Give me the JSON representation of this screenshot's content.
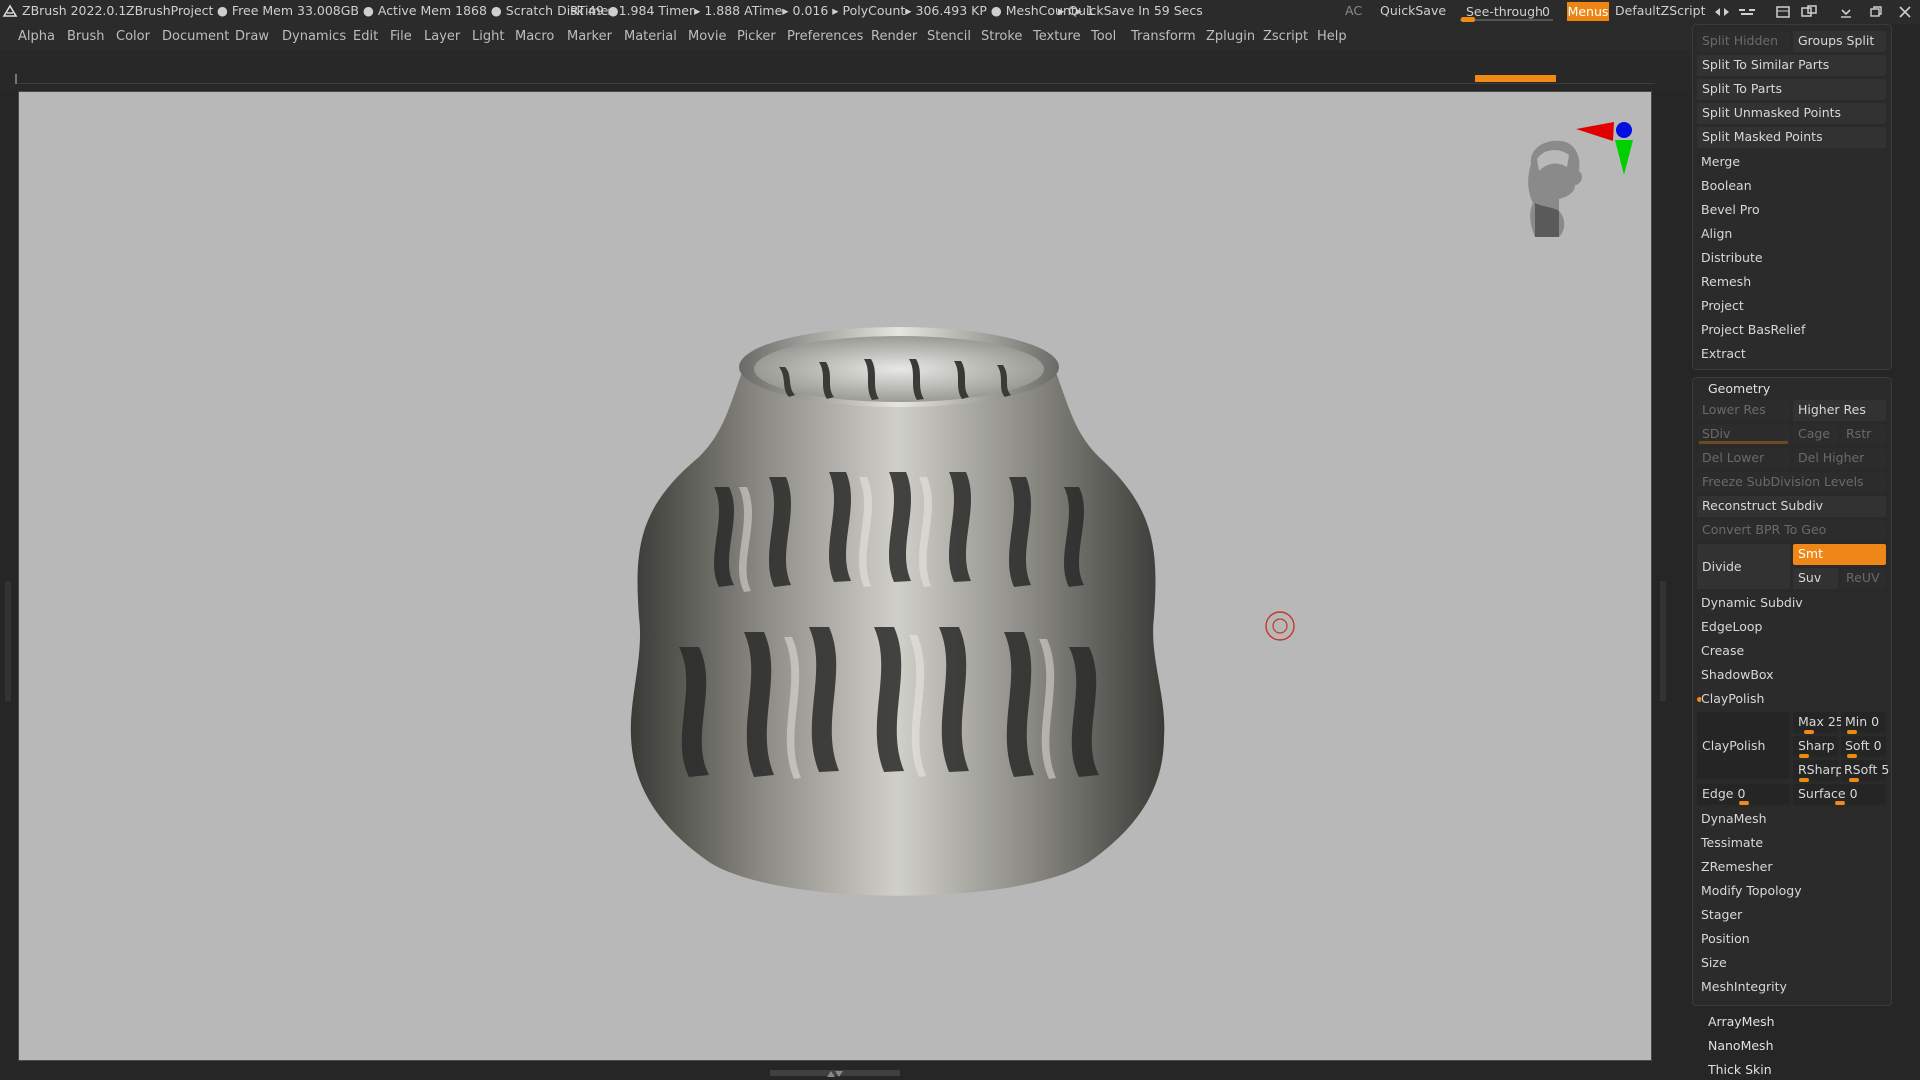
{
  "titlebar": {
    "app": "ZBrush 2022.0.1",
    "project": "ZBrushProject",
    "status_mem": "● Free Mem 33.008GB ● Active Mem 1868 ● Scratch Disk 49 ●",
    "status_time": "RTime▸ 1.984 Timer▸ 1.888 ATime▸ 0.016 ▸ PolyCount▸ 306.493 KP ● MeshCount▸ 1",
    "quicksave_timer": "▸ QuickSave In 59 Secs",
    "ac": "AC",
    "quicksave": "QuickSave",
    "seethrough_label": "See-through",
    "seethrough_value": "0",
    "menus": "Menus",
    "script": "DefaultZScript"
  },
  "menubar": [
    "Alpha",
    "Brush",
    "Color",
    "Document",
    "Draw",
    "Dynamics",
    "Edit",
    "File",
    "Layer",
    "Light",
    "Macro",
    "Marker",
    "Material",
    "Movie",
    "Picker",
    "Preferences",
    "Render",
    "Stencil",
    "Stroke",
    "Texture",
    "Tool",
    "Transform",
    "Zplugin",
    "Zscript",
    "Help"
  ],
  "subtool_split": {
    "split_hidden": "Split Hidden",
    "groups_split": "Groups Split",
    "items": [
      "Split To Similar Parts",
      "Split To Parts",
      "Split Unmasked Points",
      "Split Masked Points"
    ]
  },
  "subtool_items": [
    "Merge",
    "Boolean",
    "Bevel Pro",
    "Align",
    "Distribute",
    "Remesh",
    "Project",
    "Project BasRelief",
    "Extract"
  ],
  "geometry": {
    "title": "Geometry",
    "lower_res": "Lower Res",
    "higher_res": "Higher Res",
    "sdiv": "SDiv",
    "cage": "Cage",
    "rstr": "Rstr",
    "del_lower": "Del Lower",
    "del_higher": "Del Higher",
    "freeze": "Freeze SubDivision Levels",
    "reconstruct": "Reconstruct Subdiv",
    "convert_bpr": "Convert BPR To Geo",
    "divide": "Divide",
    "smt": "Smt",
    "suv": "Suv",
    "reuv": "ReUV",
    "items_a": [
      "Dynamic Subdiv",
      "EdgeLoop",
      "Crease",
      "ShadowBox"
    ],
    "claypolish_header": "ClayPolish",
    "claypolish_btn": "ClayPolish",
    "max_label": "Max",
    "max_value": "25",
    "min_label": "Min",
    "min_value": "0",
    "sharp_label": "Sharp",
    "soft_label": "Soft",
    "soft_value": "0",
    "rsharp_label": "RSharp",
    "rsoft_label": "RSoft",
    "rsoft_value": "5",
    "edge_label": "Edge",
    "edge_value": "0",
    "surface_label": "Surface",
    "surface_value": "0",
    "items_b": [
      "DynaMesh",
      "Tessimate",
      "ZRemesher",
      "Modify Topology",
      "Stager",
      "Position",
      "Size",
      "MeshIntegrity"
    ]
  },
  "tool_sections": [
    "ArrayMesh",
    "NanoMesh",
    "Thick Skin"
  ],
  "colors": {
    "accent": "#ef8718",
    "viewport": "#b8b8b8",
    "panel": "#262626"
  }
}
